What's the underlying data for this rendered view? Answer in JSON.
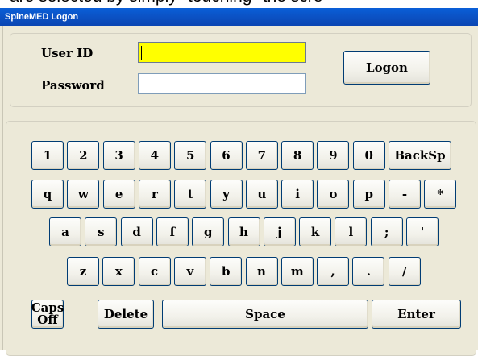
{
  "background_text": "are selected by simply \"touching\" the scre",
  "window": {
    "title": "SpineMED Logon"
  },
  "login": {
    "user_id_label": "User ID",
    "password_label": "Password",
    "user_id_value": "",
    "password_value": "",
    "logon_label": "Logon"
  },
  "keyboard": {
    "row1": [
      "1",
      "2",
      "3",
      "4",
      "5",
      "6",
      "7",
      "8",
      "9",
      "0",
      "BackSp"
    ],
    "row2": [
      "q",
      "w",
      "e",
      "r",
      "t",
      "y",
      "u",
      "i",
      "o",
      "p",
      "-",
      "*"
    ],
    "row3": [
      "a",
      "s",
      "d",
      "f",
      "g",
      "h",
      "j",
      "k",
      "l",
      ";",
      "'"
    ],
    "row4": [
      "z",
      "x",
      "c",
      "v",
      "b",
      "n",
      "m",
      ",",
      ".",
      "/"
    ],
    "caps_line1": "Caps",
    "caps_line2": "Off",
    "delete": "Delete",
    "space": "Space",
    "enter": "Enter"
  },
  "colors": {
    "active_field": "#ffff00",
    "titlebar": "#0b4fc0"
  }
}
